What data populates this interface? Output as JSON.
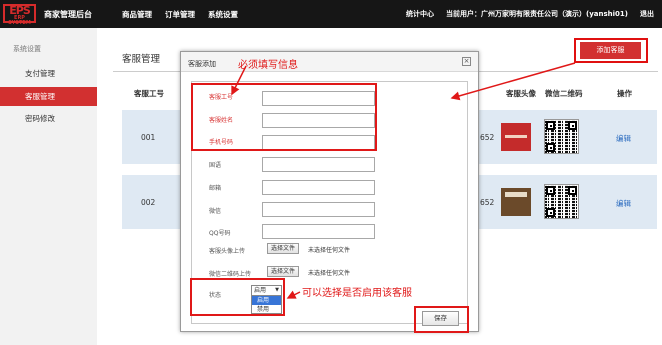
{
  "topbar": {
    "logo_main": "EPS",
    "logo_sub": "ERP SYSTEM",
    "app_title": "商家管理后台",
    "nav": [
      "商品管理",
      "订单管理",
      "系统设置"
    ],
    "right": {
      "stats": "统计中心",
      "user": "当前用户：广州万家明有限责任公司（演示）(yanshi01)",
      "logout": "退出"
    }
  },
  "sidebar": {
    "heading": "系统设置",
    "items": [
      {
        "label": "支付管理",
        "active": false
      },
      {
        "label": "客服管理",
        "active": true
      },
      {
        "label": "密码修改",
        "active": false
      }
    ]
  },
  "main": {
    "title": "客服管理",
    "add_button": "添加客服",
    "columns": [
      "客服工号",
      "客服头像",
      "微信二维码",
      "操作"
    ],
    "rows": [
      {
        "id": "001",
        "partial": "652",
        "edit": "编辑",
        "avatar_color": "#c42b2b"
      },
      {
        "id": "002",
        "partial": "652",
        "edit": "编辑",
        "avatar_color": "#6b4a2a"
      }
    ]
  },
  "modal": {
    "title": "客服添加",
    "close": "×",
    "fields": [
      {
        "label": "客服工号",
        "required": true,
        "value": ""
      },
      {
        "label": "客服姓名",
        "required": true,
        "value": ""
      },
      {
        "label": "手机号码",
        "required": true,
        "value": ""
      },
      {
        "label": "国语",
        "required": false,
        "value": ""
      },
      {
        "label": "邮箱",
        "required": false,
        "value": ""
      },
      {
        "label": "微信",
        "required": false,
        "value": ""
      },
      {
        "label": "QQ号码",
        "required": false,
        "value": ""
      }
    ],
    "uploads": [
      {
        "label": "客服头像上传",
        "button": "选择文件",
        "status": "未选择任何文件"
      },
      {
        "label": "微信二维码上传",
        "button": "选择文件",
        "status": "未选择任何文件"
      }
    ],
    "status": {
      "label": "状态",
      "selected": "启用",
      "options": [
        "启用",
        "禁用"
      ]
    },
    "save": "保存"
  },
  "annotations": {
    "required_note": "必须填写信息",
    "status_note": "可以选择是否启用该客服"
  },
  "colors": {
    "topbar": "#161616",
    "accent_red": "#d23030",
    "row_bg": "#dfe9f3",
    "annotation": "#e01818"
  }
}
